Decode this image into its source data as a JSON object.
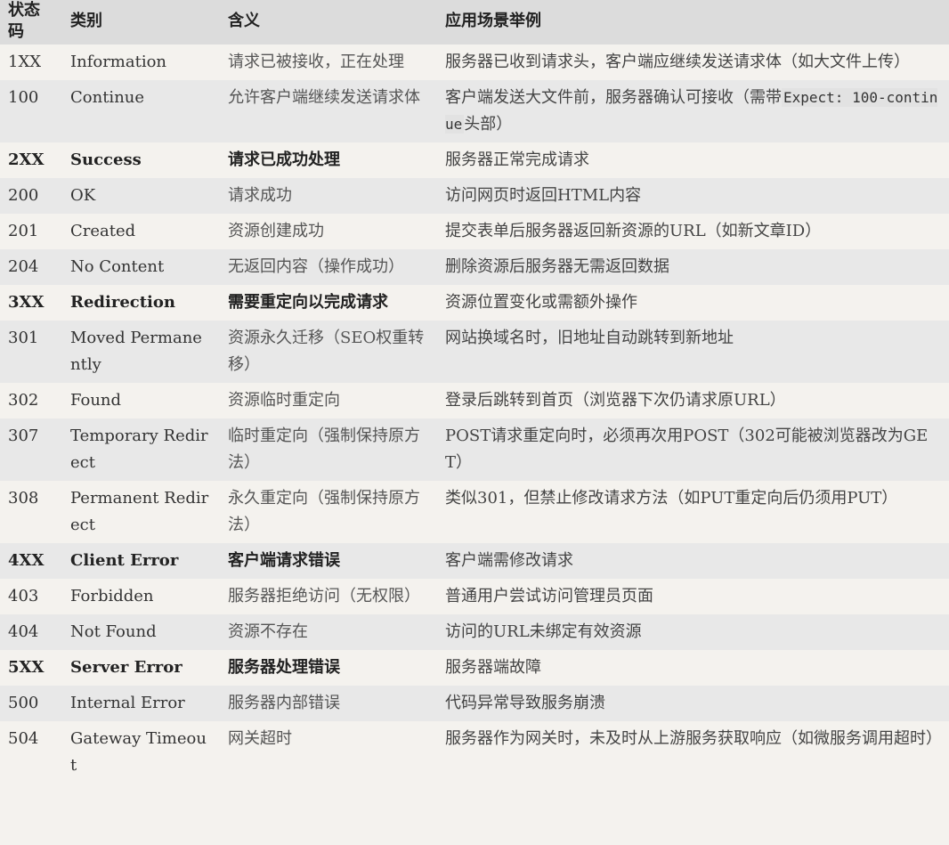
{
  "header": {
    "code": "状态码",
    "category": "类别",
    "meaning": "含义",
    "example": "应用场景举例"
  },
  "rows": [
    {
      "code": "1XX",
      "name": "Information",
      "meaning": "请求已被接收，正在处理",
      "example": "服务器已收到请求头，客户端应继续发送请求体（如大文件上传）",
      "category": false
    },
    {
      "code": "100",
      "name": "Continue",
      "meaning": "允许客户端继续发送请求体",
      "example_before": "客户端发送大文件前，服务器确认可接收（需带",
      "example_code": "Expect: 100-continue",
      "example_after": "头部）",
      "category": false
    },
    {
      "code": "2XX",
      "name": "Success",
      "meaning": "请求已成功处理",
      "example": "服务器正常完成请求",
      "category": true
    },
    {
      "code": "200",
      "name": "OK",
      "meaning": "请求成功",
      "example": "访问网页时返回HTML内容",
      "category": false
    },
    {
      "code": "201",
      "name": "Created",
      "meaning": "资源创建成功",
      "example": "提交表单后服务器返回新资源的URL（如新文章ID）",
      "category": false
    },
    {
      "code": "204",
      "name": "No Content",
      "meaning": "无返回内容（操作成功）",
      "example": "删除资源后服务器无需返回数据",
      "category": false
    },
    {
      "code": "3XX",
      "name": "Redirection",
      "meaning": "需要重定向以完成请求",
      "example": "资源位置变化或需额外操作",
      "category": true
    },
    {
      "code": "301",
      "name": "Moved Permanently",
      "meaning": "资源永久迁移（SEO权重转移）",
      "example": "网站换域名时，旧地址自动跳转到新地址",
      "category": false
    },
    {
      "code": "302",
      "name": "Found",
      "meaning": "资源临时重定向",
      "example": "登录后跳转到首页（浏览器下次仍请求原URL）",
      "category": false
    },
    {
      "code": "307",
      "name": "Temporary Redirect",
      "meaning": "临时重定向（强制保持原方法）",
      "example": "POST请求重定向时，必须再次用POST（302可能被浏览器改为GET）",
      "category": false
    },
    {
      "code": "308",
      "name": "Permanent Redirect",
      "meaning": "永久重定向（强制保持原方法）",
      "example": "类似301，但禁止修改请求方法（如PUT重定向后仍须用PUT）",
      "category": false
    },
    {
      "code": "4XX",
      "name": "Client Error",
      "meaning": "客户端请求错误",
      "example": "客户端需修改请求",
      "category": true
    },
    {
      "code": "403",
      "name": "Forbidden",
      "meaning": "服务器拒绝访问（无权限）",
      "example": "普通用户尝试访问管理员页面",
      "category": false
    },
    {
      "code": "404",
      "name": "Not Found",
      "meaning": "资源不存在",
      "example": "访问的URL未绑定有效资源",
      "category": false
    },
    {
      "code": "5XX",
      "name": "Server Error",
      "meaning": "服务器处理错误",
      "example": "服务器端故障",
      "category": true
    },
    {
      "code": "500",
      "name": "Internal Error",
      "meaning": "服务器内部错误",
      "example": "代码异常导致服务崩溃",
      "category": false
    },
    {
      "code": "504",
      "name": "Gateway Timeout",
      "meaning": "网关超时",
      "example": "服务器作为网关时，未及时从上游服务获取响应（如微服务调用超时）",
      "category": false
    }
  ]
}
